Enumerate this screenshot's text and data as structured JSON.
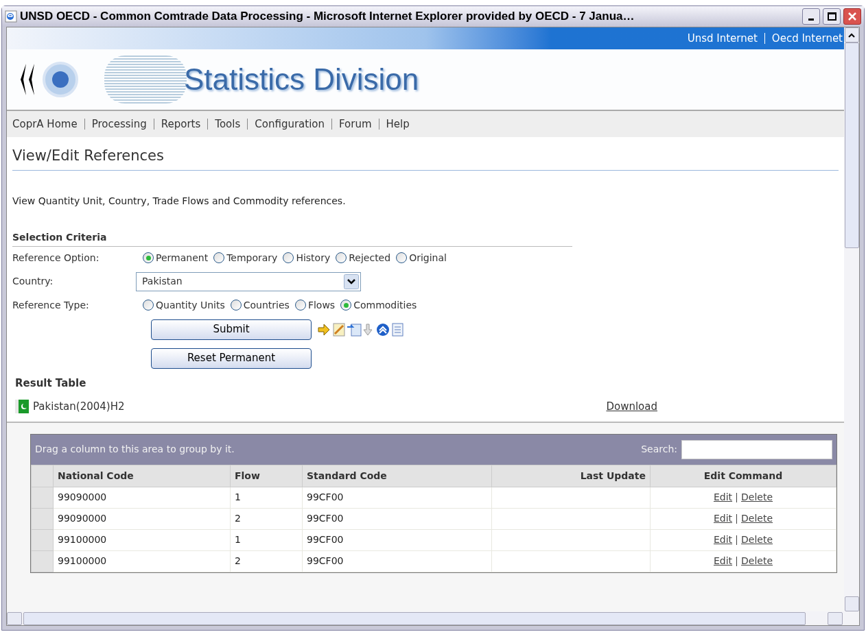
{
  "window": {
    "title": "UNSD OECD - Common Comtrade Data Processing - Microsoft Internet Explorer provided by OECD - 7 Janua…"
  },
  "top_links": [
    "Unsd Internet",
    "Oecd Internet"
  ],
  "banner": {
    "title": "Statistics Division"
  },
  "nav": [
    "CoprA Home",
    "Processing",
    "Reports",
    "Tools",
    "Configuration",
    "Forum",
    "Help"
  ],
  "page_title": "View/Edit References",
  "description": "View Quantity Unit, Country, Trade Flows and Commodity references.",
  "selection": {
    "heading": "Selection Criteria",
    "reference_option": {
      "label": "Reference Option:",
      "options": [
        {
          "label": "Permanent",
          "selected": true
        },
        {
          "label": "Temporary",
          "selected": false
        },
        {
          "label": "History",
          "selected": false
        },
        {
          "label": "Rejected",
          "selected": false
        },
        {
          "label": "Original",
          "selected": false
        }
      ]
    },
    "country": {
      "label": "Country:",
      "value": "Pakistan"
    },
    "reference_type": {
      "label": "Reference Type:",
      "options": [
        {
          "label": "Quantity Units",
          "selected": false
        },
        {
          "label": "Countries",
          "selected": false
        },
        {
          "label": "Flows",
          "selected": false
        },
        {
          "label": "Commodities",
          "selected": true
        }
      ]
    },
    "buttons": [
      "Submit",
      "Reset Permanent"
    ]
  },
  "result": {
    "heading": "Result Table",
    "dataset": "Pakistan(2004)H2",
    "download": "Download"
  },
  "grid": {
    "group_hint": "Drag a column to this area to group by it.",
    "search_label": "Search:",
    "columns": [
      "National Code",
      "Flow",
      "Standard Code",
      "Last Update",
      "Edit Command"
    ],
    "rows": [
      {
        "national_code": "99090000",
        "flow": "1",
        "standard_code": "99CF00",
        "last_update": "",
        "commands": [
          "Edit",
          "Delete"
        ]
      },
      {
        "national_code": "99090000",
        "flow": "2",
        "standard_code": "99CF00",
        "commands": [
          "Edit",
          "Delete"
        ]
      },
      {
        "national_code": "99100000",
        "flow": "1",
        "standard_code": "99CF00",
        "commands": [
          "Edit",
          "Delete"
        ]
      },
      {
        "national_code": "99100000",
        "flow": "2",
        "standard_code": "99CF00",
        "commands": [
          "Edit",
          "Delete"
        ]
      }
    ]
  }
}
